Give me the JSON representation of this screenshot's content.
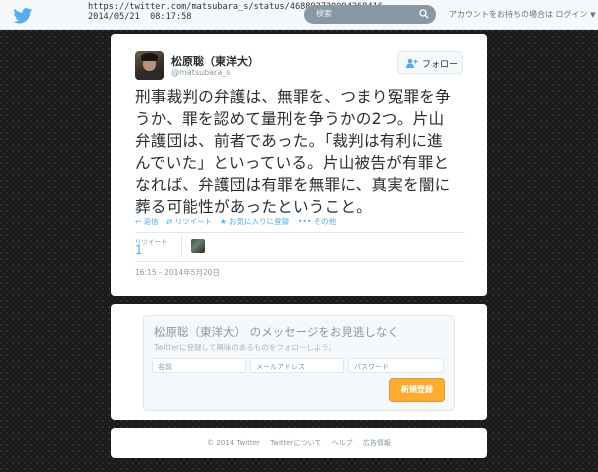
{
  "browser_overlay": {
    "url": "https://twitter.com/matsubara_s/status/468892730094268416",
    "datetime": "2014/05/21  08:17:58"
  },
  "topbar": {
    "logo_icon": "twitter-bird-icon",
    "search_placeholder": "検索",
    "search_icon": "magnifier-icon",
    "login_text": "アカウントをお持ちの場合は ログイン"
  },
  "tweet": {
    "fullname": "松原聡（東洋大）",
    "screen_name": "@matsubara_s",
    "follow_label": "フォロー",
    "text_lines": [
      "刑事裁判の弁護は、無罪を、つまり冤罪を争",
      "うか、罪を認めて量刑を争うかの2つ。片山",
      "弁護団は、前者であった。「裁判は有利に進",
      "んでいた」といっている。片山被告が有罪と",
      "なれば、弁護団は有罪を無罪に、真実を闇に",
      "葬る可能性があったということ。"
    ],
    "actions": {
      "reply": "返信",
      "retweet": "リツイート",
      "favorite": "お気に入りに登録",
      "more": "その他"
    },
    "stats": {
      "retweet_label": "リツイート",
      "retweet_count": "1"
    },
    "timestamp": "16:15 - 2014年5月20日"
  },
  "signup": {
    "title": "松原聡（東洋大） のメッセージをお見逃しなく",
    "subtitle": "Twitterに登録して興味のあるものをフォローしよう。",
    "name_placeholder": "名前",
    "email_placeholder": "メールアドレス",
    "password_placeholder": "パスワード",
    "button_label": "新規登録"
  },
  "footer": {
    "copyright": "© 2014 Twitter",
    "about": "Twitterについて",
    "help": "ヘルプ",
    "ads": "広告情報"
  },
  "colors": {
    "accent": "#55acee",
    "signup_button": "#ffac33",
    "muted": "#8899a6"
  }
}
